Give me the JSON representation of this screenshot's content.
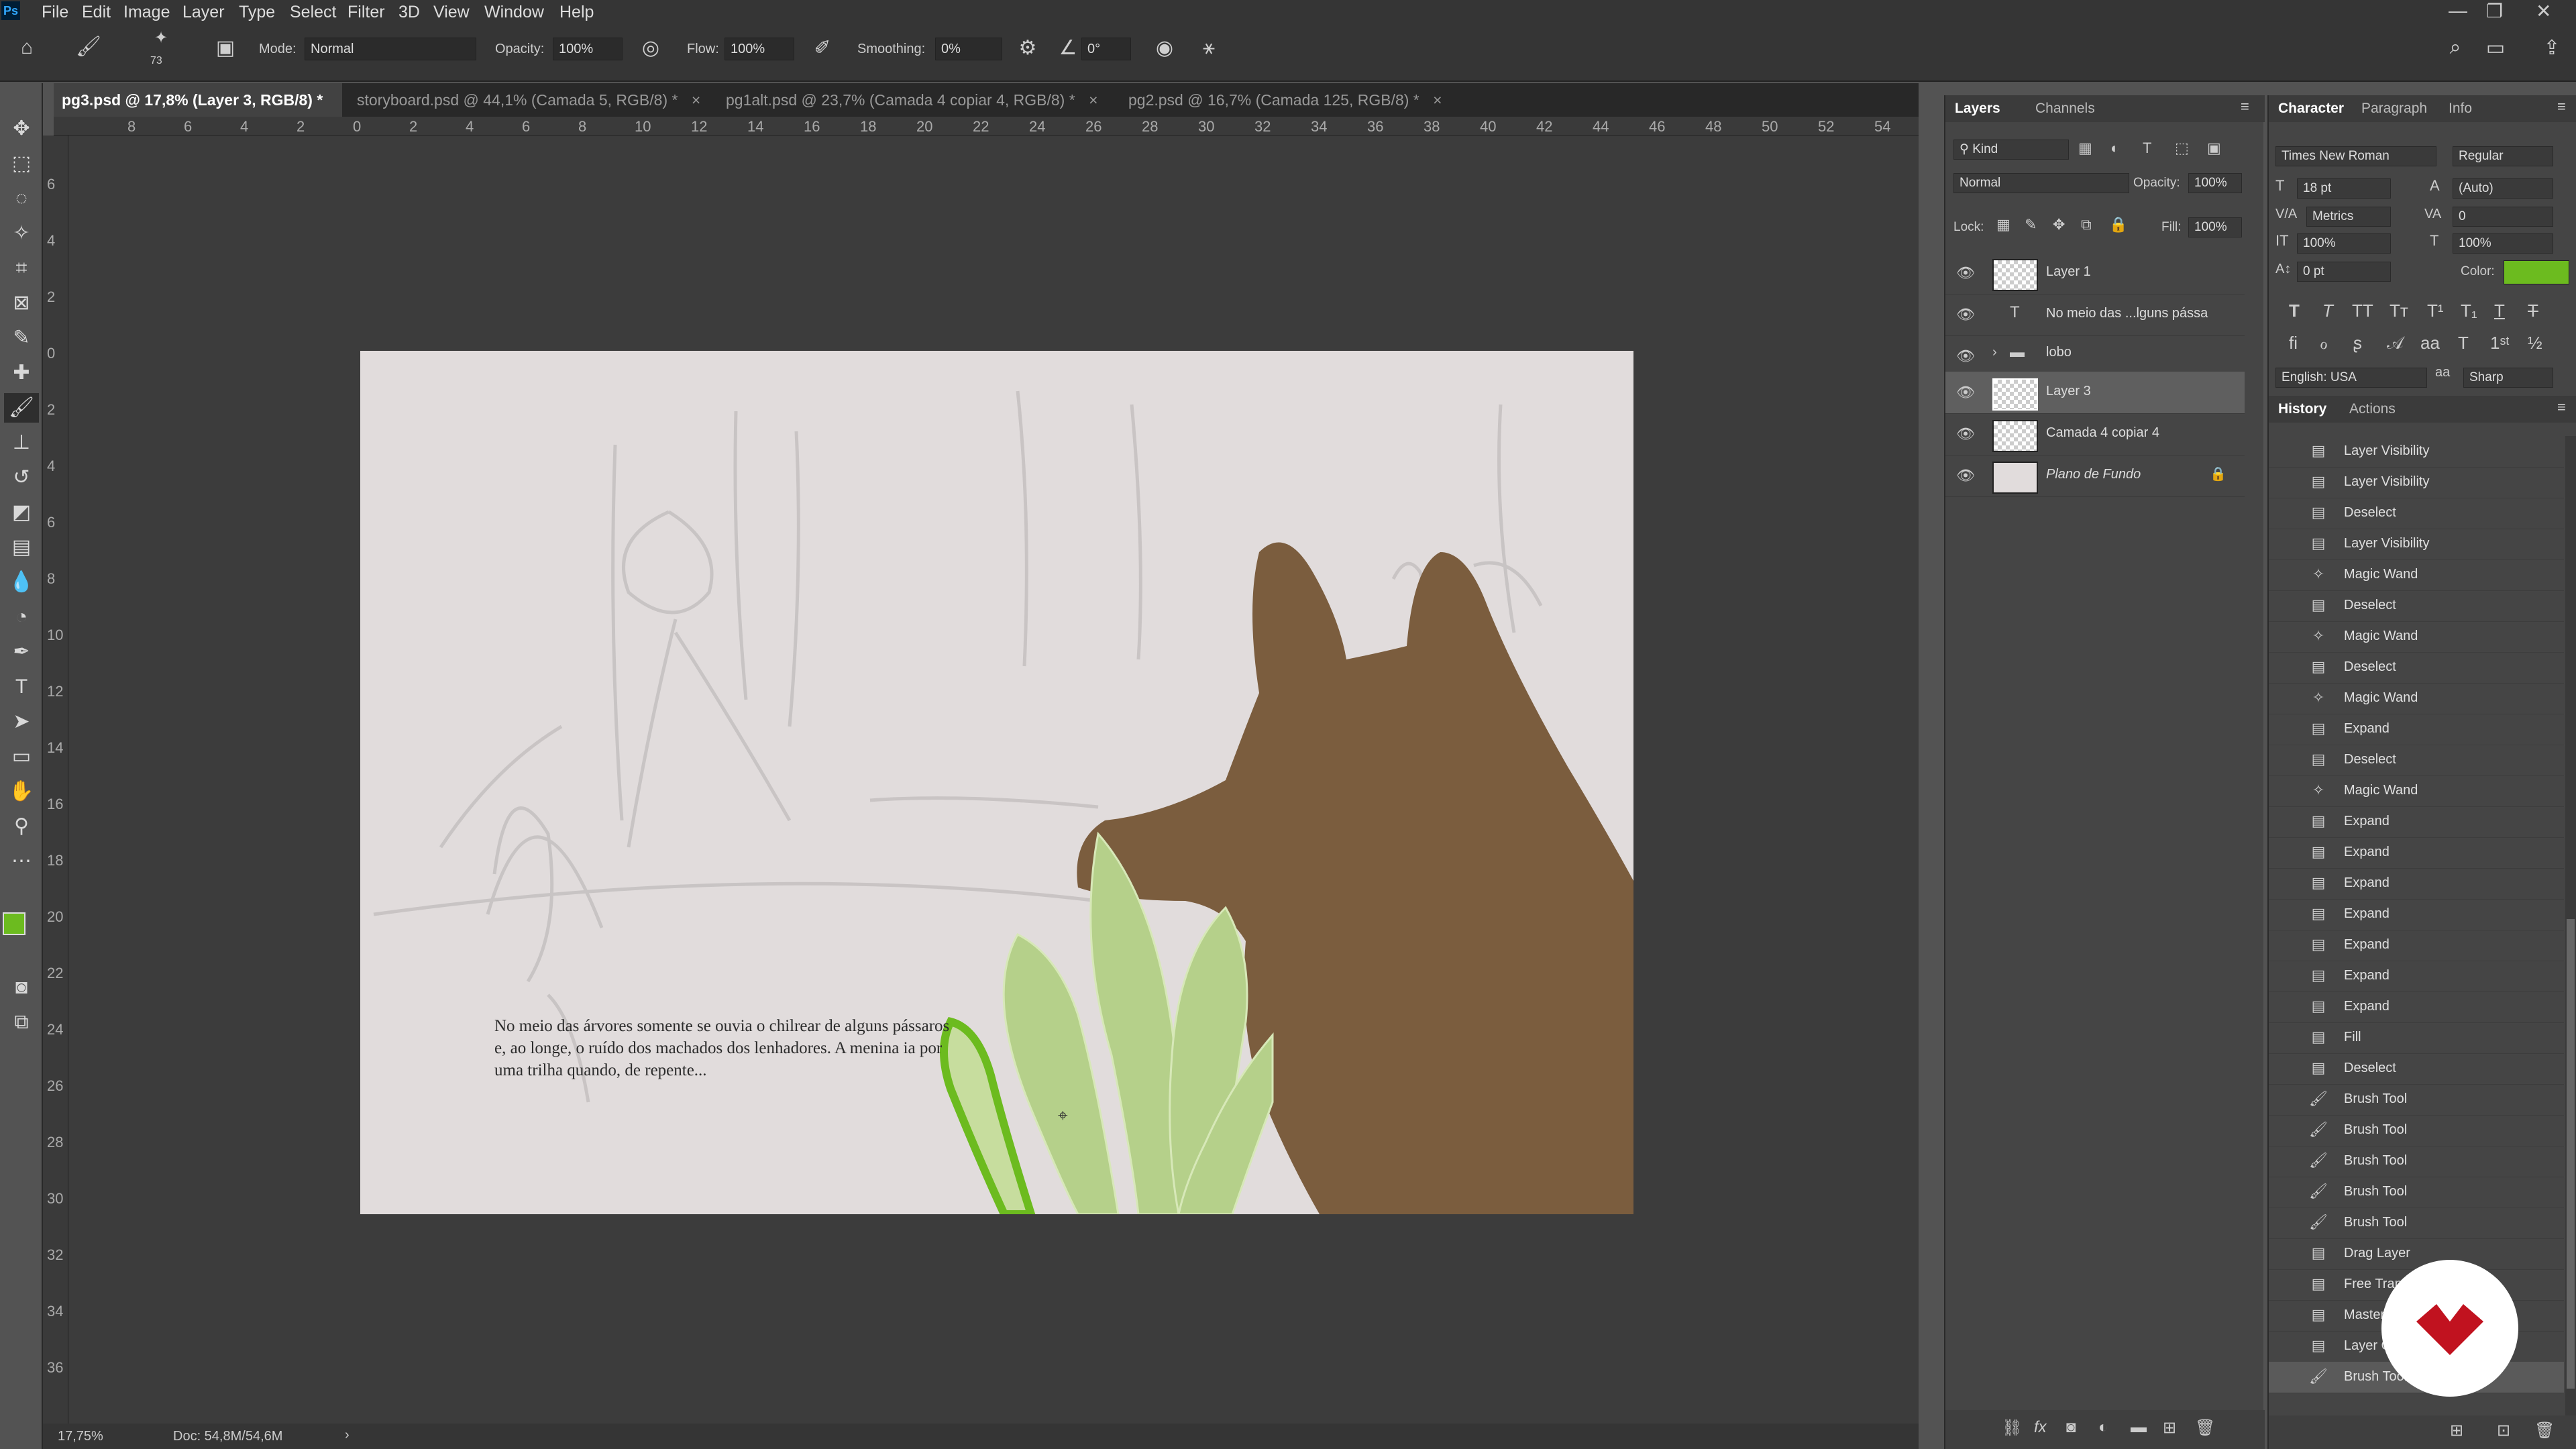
{
  "menu": {
    "logo": "Ps",
    "items": [
      "File",
      "Edit",
      "Image",
      "Layer",
      "Type",
      "Select",
      "Filter",
      "3D",
      "View",
      "Window",
      "Help"
    ]
  },
  "options": {
    "brush_size": "73",
    "mode_label": "Mode:",
    "mode_value": "Normal",
    "opacity_label": "Opacity:",
    "opacity_value": "100%",
    "flow_label": "Flow:",
    "flow_value": "100%",
    "smoothing_label": "Smoothing:",
    "smoothing_value": "0%",
    "angle_value": "0°"
  },
  "tabs": [
    {
      "label": "pg3.psd @ 17,8% (Layer 3, RGB/8) *"
    },
    {
      "label": "storyboard.psd @ 44,1% (Camada 5, RGB/8) *"
    },
    {
      "label": "pg1alt.psd @ 23,7% (Camada 4 copiar 4, RGB/8) *"
    },
    {
      "label": "pg2.psd @ 16,7% (Camada 125, RGB/8) *"
    }
  ],
  "ruler_top": [
    "8",
    "6",
    "4",
    "2",
    "0",
    "2",
    "4",
    "6",
    "8",
    "10",
    "12",
    "14",
    "16",
    "18",
    "20",
    "22",
    "24",
    "26",
    "28",
    "30",
    "32",
    "34",
    "36",
    "38",
    "40",
    "42",
    "44",
    "46",
    "48",
    "50",
    "52",
    "54"
  ],
  "ruler_left": [
    "6",
    "4",
    "2",
    "0",
    "2",
    "4",
    "6",
    "8",
    "10",
    "12",
    "14",
    "16",
    "18",
    "20",
    "22",
    "24",
    "26",
    "28",
    "30",
    "32",
    "34",
    "36"
  ],
  "canvas_text": "No meio das árvores somente se ouvia o chilrear de alguns pássaros e, ao longe, o ruído dos machados dos lenhadores. A menina ia por uma trilha quando, de repente...",
  "status": {
    "zoom": "17,75%",
    "doc": "Doc: 54,8M/54,6M"
  },
  "layers_panel": {
    "tabs": [
      "Layers",
      "Channels"
    ],
    "kind_label": "Kind",
    "blend_mode": "Normal",
    "opacity_label": "Opacity:",
    "opacity_value": "100%",
    "lock_label": "Lock:",
    "fill_label": "Fill:",
    "fill_value": "100%",
    "layers": [
      {
        "name": "Layer 1"
      },
      {
        "name": "No meio das ...lguns pássa"
      },
      {
        "name": "lobo"
      },
      {
        "name": "Layer 3"
      },
      {
        "name": "Camada 4 copiar 4"
      },
      {
        "name": "Plano de Fundo"
      }
    ]
  },
  "character_panel": {
    "tabs": [
      "Character",
      "Paragraph",
      "Info"
    ],
    "font_family": "Times New Roman",
    "font_style": "Regular",
    "font_size": "18 pt",
    "leading": "(Auto)",
    "kerning": "Metrics",
    "tracking": "0",
    "vscale": "100%",
    "hscale": "100%",
    "baseline": "0 pt",
    "color_label": "Color:",
    "color_value": "#6cbb1f",
    "language": "English: USA",
    "antialias": "Sharp"
  },
  "history_panel": {
    "tabs": [
      "History",
      "Actions"
    ],
    "items": [
      {
        "label": "Layer Visibility",
        "icon": "doc-icon"
      },
      {
        "label": "Layer Visibility",
        "icon": "doc-icon"
      },
      {
        "label": "Deselect",
        "icon": "doc-icon"
      },
      {
        "label": "Layer Visibility",
        "icon": "doc-icon"
      },
      {
        "label": "Magic Wand",
        "icon": "wand-icon"
      },
      {
        "label": "Deselect",
        "icon": "doc-icon"
      },
      {
        "label": "Magic Wand",
        "icon": "wand-icon"
      },
      {
        "label": "Deselect",
        "icon": "doc-icon"
      },
      {
        "label": "Magic Wand",
        "icon": "wand-icon"
      },
      {
        "label": "Expand",
        "icon": "doc-icon"
      },
      {
        "label": "Deselect",
        "icon": "doc-icon"
      },
      {
        "label": "Magic Wand",
        "icon": "wand-icon"
      },
      {
        "label": "Expand",
        "icon": "doc-icon"
      },
      {
        "label": "Expand",
        "icon": "doc-icon"
      },
      {
        "label": "Expand",
        "icon": "doc-icon"
      },
      {
        "label": "Expand",
        "icon": "doc-icon"
      },
      {
        "label": "Expand",
        "icon": "doc-icon"
      },
      {
        "label": "Expand",
        "icon": "doc-icon"
      },
      {
        "label": "Expand",
        "icon": "doc-icon"
      },
      {
        "label": "Fill",
        "icon": "doc-icon"
      },
      {
        "label": "Deselect",
        "icon": "doc-icon"
      },
      {
        "label": "Brush Tool",
        "icon": "brush-icon"
      },
      {
        "label": "Brush Tool",
        "icon": "brush-icon"
      },
      {
        "label": "Brush Tool",
        "icon": "brush-icon"
      },
      {
        "label": "Brush Tool",
        "icon": "brush-icon"
      },
      {
        "label": "Brush Tool",
        "icon": "brush-icon"
      },
      {
        "label": "Drag Layer",
        "icon": "doc-icon"
      },
      {
        "label": "Free Transform",
        "icon": "doc-icon"
      },
      {
        "label": "Master Opacity Change",
        "icon": "doc-icon"
      },
      {
        "label": "Layer Order",
        "icon": "doc-icon"
      },
      {
        "label": "Brush Tool",
        "icon": "brush-icon"
      }
    ]
  },
  "colors": {
    "foreground": "#6cbb1f",
    "background": "#ffffff",
    "wolf": "#7b5d3e",
    "leaf": "#b5d08a",
    "leaf_stroke": "#6cbb1f",
    "paper": "#e1dcdc"
  }
}
